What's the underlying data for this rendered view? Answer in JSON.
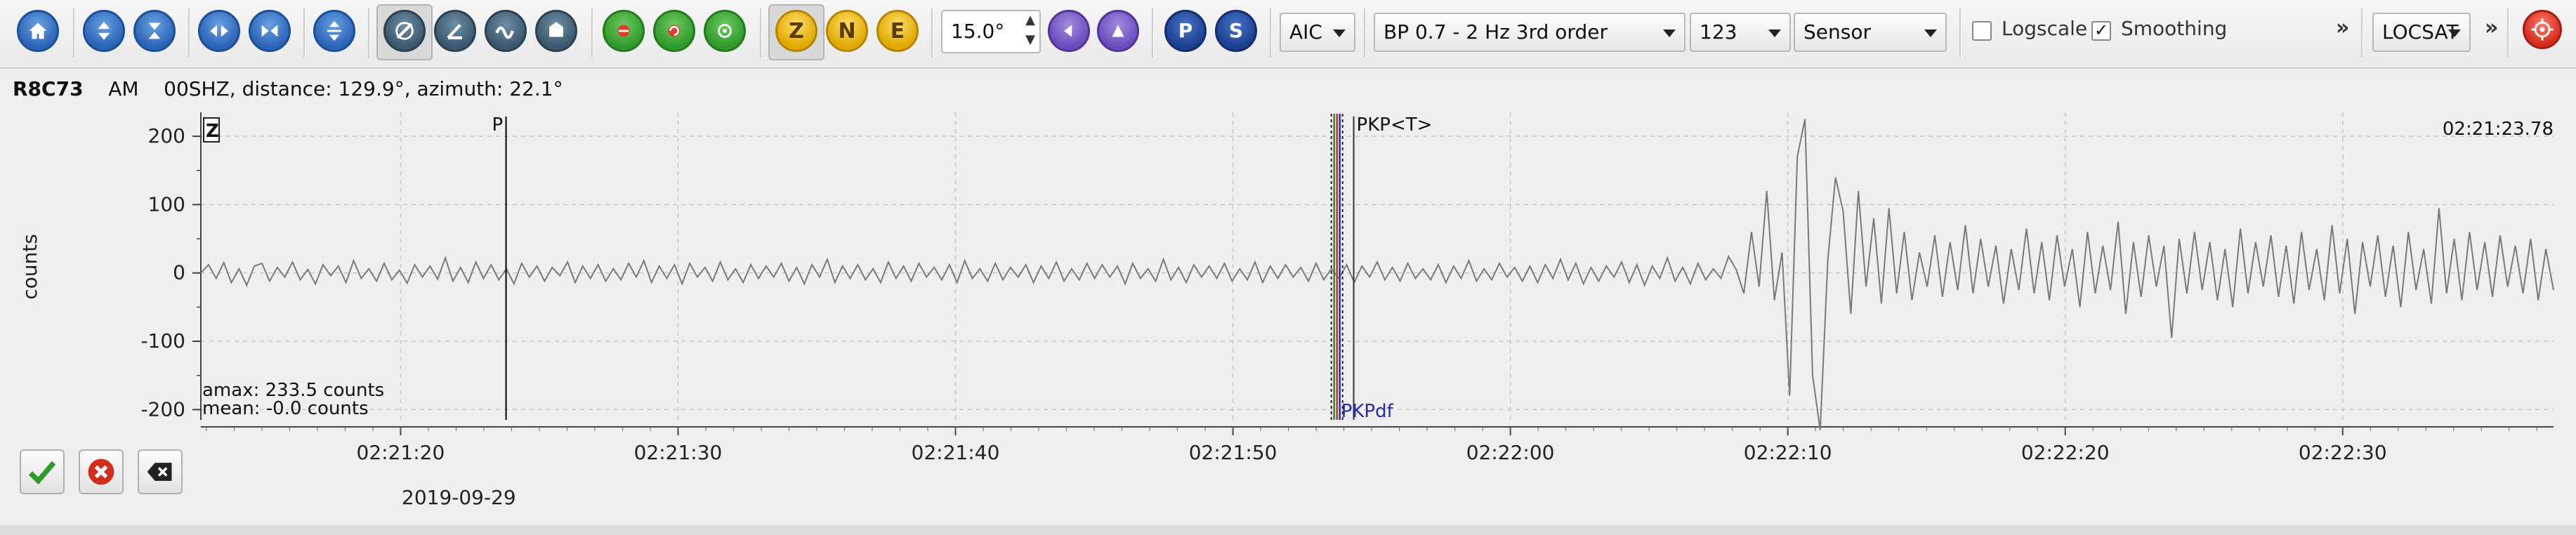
{
  "toolbar": {
    "angle_value": "15.0°",
    "picker_select": "AIC",
    "filter_select": "BP 0.7 - 2 Hz  3rd order",
    "channel_select": "123",
    "units_select": "Sensor",
    "logscale_label": "Logscale",
    "logscale_checked": false,
    "smoothing_label": "Smoothing",
    "smoothing_checked": true,
    "locator_select": "LOCSAT",
    "more_1": "»",
    "more_2": "»",
    "letter_buttons": [
      "Z",
      "N",
      "E",
      "P",
      "S"
    ]
  },
  "trace": {
    "station": "R8C73",
    "network": "AM",
    "channel": "00SHZ",
    "distance_text": "distance: 129.9°",
    "azimuth_text": "azimuth: 22.1°",
    "component_badge": "Z",
    "time_readout": "02:21:23.78",
    "y_axis_label": "counts",
    "amax_text": "amax: 233.5 counts",
    "mean_text": "mean: -0.0 counts",
    "date_text": "2019-09-29"
  },
  "chart_data": {
    "type": "line",
    "ylabel": "counts",
    "y_ticks": [
      "200",
      "100",
      "0",
      "-100",
      "-200"
    ],
    "ylim": [
      -215,
      235
    ],
    "x_ticks": [
      "02:21:20",
      "02:21:30",
      "02:21:40",
      "02:21:50",
      "02:22:00",
      "02:22:10",
      "02:22:20",
      "02:22:30"
    ],
    "x_range": [
      "02:21:12.8",
      "02:22:37.6"
    ],
    "grid": true,
    "picks": [
      {
        "label": "P",
        "time": "02:21:23.8"
      },
      {
        "label": "PKP<T>",
        "time": "02:21:54.1"
      },
      {
        "label": "PKPdf",
        "time": "02:21:53.8"
      }
    ],
    "series": [
      {
        "values": [
          0,
          12,
          -8,
          15,
          -14,
          6,
          -18,
          10,
          14,
          -12,
          8,
          -6,
          16,
          -10,
          5,
          -16,
          12,
          -4,
          10,
          -14,
          18,
          -8,
          6,
          -12,
          14,
          -10,
          4,
          -15,
          12,
          -6,
          10,
          -9,
          22,
          -12,
          8,
          -14,
          16,
          -8,
          12,
          -10,
          6,
          -16,
          14,
          -6,
          10,
          -12,
          8,
          -4,
          16,
          -14,
          10,
          -8,
          12,
          -12,
          6,
          -10,
          14,
          -6,
          18,
          -14,
          10,
          -8,
          12,
          -16,
          14,
          -6,
          8,
          -12,
          16,
          -10,
          6,
          -14,
          12,
          -8,
          10,
          -6,
          14,
          -12,
          8,
          -16,
          12,
          -6,
          20,
          -14,
          10,
          -8,
          12,
          -10,
          6,
          -14,
          16,
          -8,
          10,
          -12,
          14,
          -6,
          8,
          -10,
          12,
          -14,
          18,
          -8,
          6,
          -12,
          14,
          -10,
          8,
          -6,
          12,
          -14,
          10,
          -8,
          16,
          -12,
          6,
          -10,
          14,
          -8,
          12,
          -6,
          10,
          -16,
          14,
          -8,
          6,
          -12,
          20,
          -10,
          8,
          -14,
          12,
          -6,
          10,
          -8,
          14,
          -12,
          6,
          -10,
          16,
          -14,
          10,
          -8,
          12,
          -6,
          8,
          -12,
          14,
          -10,
          6,
          -8,
          12,
          -14,
          10,
          -6,
          16,
          -10,
          8,
          -12,
          14,
          -8,
          6,
          -10,
          12,
          -14,
          10,
          -8,
          18,
          -12,
          6,
          -10,
          14,
          -6,
          8,
          -12,
          10,
          -14,
          12,
          -8,
          20,
          -10,
          14,
          -16,
          8,
          -12,
          10,
          -6,
          16,
          -14,
          12,
          -18,
          10,
          -8,
          22,
          -12,
          8,
          -16,
          14,
          -10,
          6,
          -8,
          24,
          5,
          -30,
          60,
          -20,
          120,
          -40,
          30,
          -180,
          170,
          225,
          -150,
          -230,
          20,
          140,
          90,
          -60,
          120,
          -20,
          80,
          -45,
          95,
          -30,
          60,
          -40,
          30,
          -20,
          55,
          -35,
          45,
          -25,
          70,
          -30,
          50,
          -20,
          40,
          -45,
          35,
          -25,
          65,
          -30,
          45,
          -40,
          55,
          -20,
          35,
          -50,
          60,
          -30,
          40,
          -25,
          75,
          -60,
          45,
          -35,
          55,
          -20,
          40,
          -95,
          50,
          -30,
          60,
          -25,
          45,
          -40,
          35,
          -50,
          65,
          -30,
          45,
          -20,
          55,
          -35,
          40,
          -45,
          60,
          -25,
          35,
          -40,
          70,
          -30,
          50,
          -60,
          45,
          -20,
          55,
          -35,
          40,
          -50,
          60,
          -25,
          35,
          -45,
          95,
          -30,
          50,
          -40,
          60,
          -25,
          45,
          -35,
          55,
          -20,
          40,
          -30,
          50,
          -40,
          35,
          -25
        ]
      }
    ]
  },
  "colors": {
    "trace": "#7a7a7a",
    "grid": "#c8c8c8",
    "pick_p": "#000000",
    "pick_green": "#2e8b2e",
    "pick_red": "#d03020",
    "pick_blue": "#2030b0",
    "pick_label_blue": "#2a2aa8"
  }
}
